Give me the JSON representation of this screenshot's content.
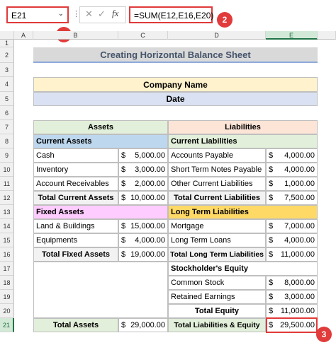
{
  "formula_bar": {
    "name_box": "E21",
    "formula": "=SUM(E12,E16,E20)",
    "fx_label": "fx"
  },
  "markers": [
    "1",
    "2",
    "3"
  ],
  "columns": [
    "A",
    "B",
    "C",
    "D",
    "E"
  ],
  "rows": [
    "1",
    "2",
    "3",
    "4",
    "5",
    "6",
    "7",
    "8",
    "9",
    "10",
    "11",
    "12",
    "13",
    "14",
    "15",
    "16",
    "17",
    "18",
    "19",
    "20",
    "21"
  ],
  "sheet": {
    "title": "Creating Horizontal Balance Sheet",
    "company_name": "Company Name",
    "date": "Date",
    "assets_header": "Assets",
    "liabilities_header": "Liabilities",
    "current_assets": "Current Assets",
    "current_liabilities": "Current Liabilities",
    "cash": "Cash",
    "cash_value": "5,000.00",
    "accounts_payable": "Accounts Payable",
    "accounts_payable_value": "4,000.00",
    "inventory": "Inventory",
    "inventory_value": "3,000.00",
    "short_term_notes": "Short Term Notes Payable",
    "short_term_notes_value": "4,000.00",
    "account_receivables": "Account Receivables",
    "account_receivables_value": "2,000.00",
    "other_current_liabilities": "Other Current Liabilities",
    "other_current_liabilities_value": "1,000.00",
    "total_current_assets": "Total Current Assets",
    "total_current_assets_value": "10,000.00",
    "total_current_liabilities": "Total Current Liabilities",
    "total_current_liabilities_value": "7,500.00",
    "fixed_assets": "Fixed Assets",
    "long_term_liabilities": "Long Term Liabilities",
    "land_buildings": "Land & Buildings",
    "land_buildings_value": "15,000.00",
    "mortgage": "Mortgage",
    "mortgage_value": "7,000.00",
    "equipments": "Equipments",
    "equipments_value": "4,000.00",
    "long_term_loans": "Long Term Loans",
    "long_term_loans_value": "4,000.00",
    "total_fixed_assets": "Total Fixed Assets",
    "total_fixed_assets_value": "19,000.00",
    "total_long_term_liabilities": "Total Long Term Liabilities",
    "total_long_term_liabilities_value": "11,000.00",
    "stockholders_equity": "Stockholder's Equity",
    "common_stock": "Common Stock",
    "common_stock_value": "8,000.00",
    "retained_earnings": "Retained Earnings",
    "retained_earnings_value": "3,000.00",
    "total_equity": "Total Equity",
    "total_equity_value": "11,000.00",
    "total_assets": "Total Assets",
    "total_assets_value": "29,000.00",
    "total_liabilities_equity": "Total Liabilities & Equity",
    "total_liabilities_equity_value": "29,500.00",
    "currency": "$"
  },
  "colors": {
    "company_fill": "#fff2cc",
    "date_fill": "#d9e1f2",
    "assets_header_fill": "#e2efda",
    "liabilities_header_fill": "#fce4d6",
    "current_assets_fill": "#bdd7ee",
    "current_liabilities_fill": "#e2efda",
    "fixed_assets_fill": "#ffccff",
    "long_term_fill": "#ffd966",
    "selection": "#e03a3a",
    "excel_green": "#217346"
  }
}
